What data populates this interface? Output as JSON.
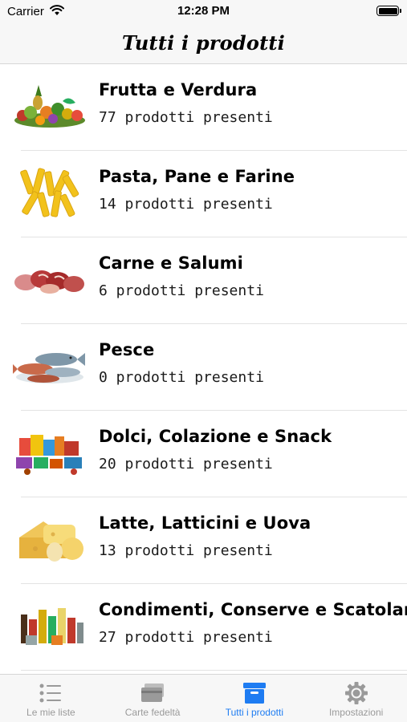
{
  "status_bar": {
    "carrier": "Carrier",
    "time": "12:28 PM"
  },
  "nav": {
    "title": "Tutti i prodotti"
  },
  "categories": [
    {
      "name": "Frutta e Verdura",
      "count": "77 prodotti presenti"
    },
    {
      "name": "Pasta, Pane e Farine",
      "count": "14 prodotti presenti"
    },
    {
      "name": "Carne e Salumi",
      "count": "6 prodotti presenti"
    },
    {
      "name": "Pesce",
      "count": "0 prodotti presenti"
    },
    {
      "name": "Dolci, Colazione e Snack",
      "count": "20 prodotti presenti"
    },
    {
      "name": "Latte, Latticini e Uova",
      "count": "13 prodotti presenti"
    },
    {
      "name": "Condimenti, Conserve e Scatolame",
      "count": "27 prodotti presenti"
    }
  ],
  "tabs": [
    {
      "label": "Le mie liste",
      "icon": "list-icon",
      "active": false
    },
    {
      "label": "Carte fedeltà",
      "icon": "cards-icon",
      "active": false
    },
    {
      "label": "Tutti i prodotti",
      "icon": "box-icon",
      "active": true
    },
    {
      "label": "Impostazioni",
      "icon": "gear-icon",
      "active": false
    }
  ],
  "colors": {
    "accent": "#1e7cf2",
    "inactive": "#9a9a9a",
    "bar_bg": "#f7f7f7"
  }
}
